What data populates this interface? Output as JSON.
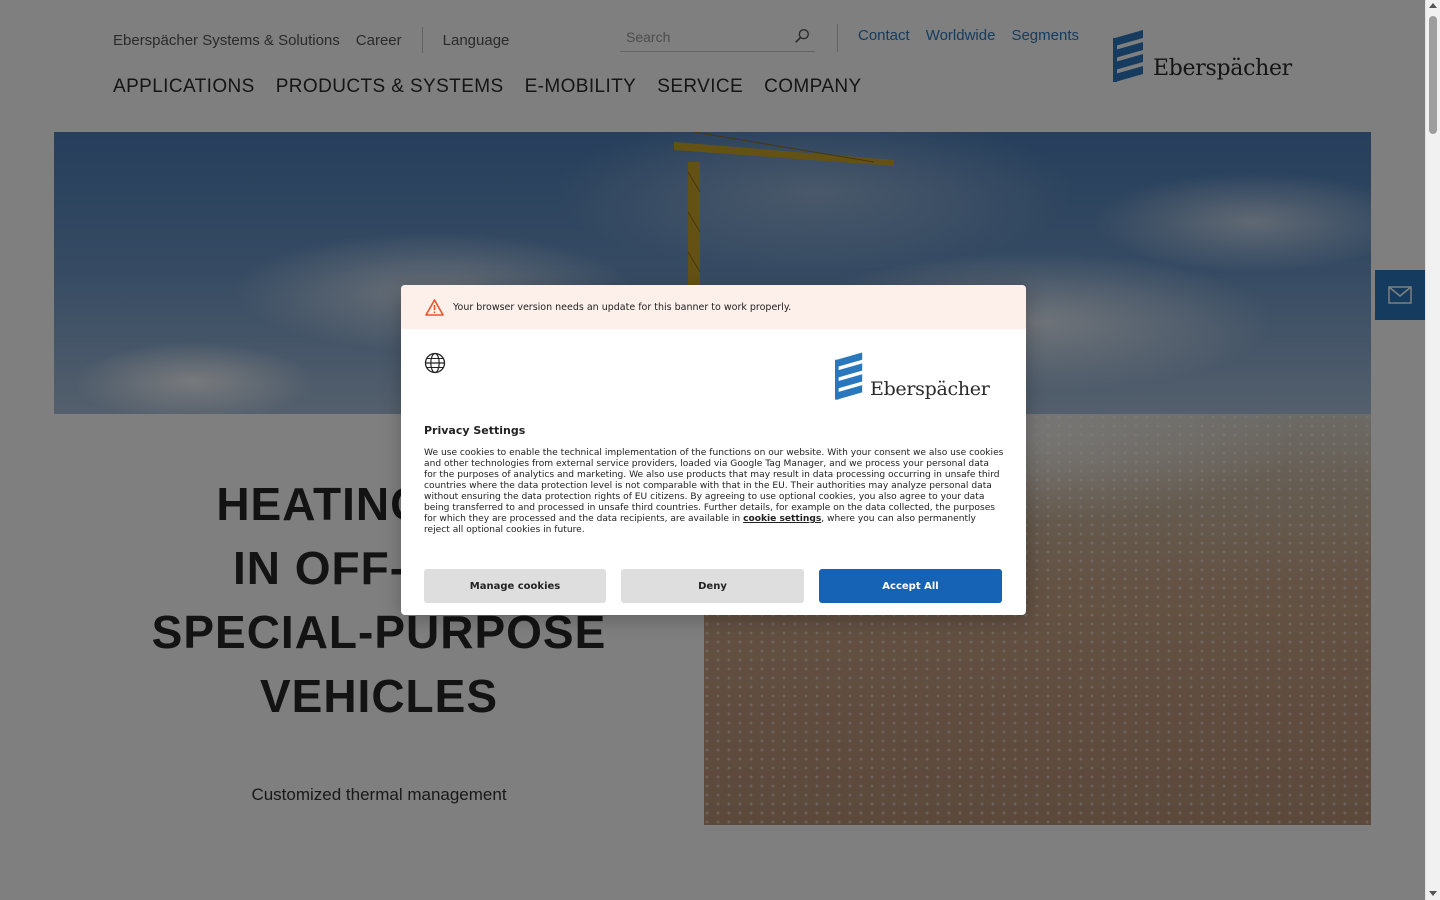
{
  "header": {
    "top_left_links": [
      "Eberspächer Systems & Solutions",
      "Career",
      "Language"
    ],
    "search_placeholder": "Search",
    "top_right_links": [
      "Contact",
      "Worldwide",
      "Segments"
    ],
    "logo_text": "Eberspächer"
  },
  "main_nav": [
    "APPLICATIONS",
    "PRODUCTS & SYSTEMS",
    "E-MOBILITY",
    "SERVICE",
    "COMPANY"
  ],
  "hero": {
    "headline_lines": [
      "HEATING AND",
      "IN OFF-HIGH",
      "SPECIAL-PURPOSE",
      "VEHICLES"
    ],
    "subline": "Customized thermal management"
  },
  "cookie_dialog": {
    "warning": "Your browser version needs an update for this banner to work properly.",
    "logo_text": "Eberspächer",
    "title": "Privacy Settings",
    "body_before_link": "We use cookies to enable the technical implementation of the functions on our website. With your consent we also use cookies and other technologies from external service providers, loaded via Google Tag Manager, and we process your personal data for the purposes of analytics and marketing. We also use products that may result in data processing occurring in unsafe third countries where the data protection level is not comparable with that in the EU. Their authorities may analyze personal data without ensuring the data protection rights of EU citizens. By agreeing to use optional cookies, you also agree to your data being transferred to and processed in unsafe third countries. Further details, for example on the data collected, the purposes for which they are processed and the data recipients, are available in ",
    "link_text": "cookie settings",
    "body_after_link": ", where you can also permanently reject all optional cookies in future.",
    "buttons": {
      "manage": "Manage cookies",
      "deny": "Deny",
      "accept": "Accept All"
    }
  },
  "colors": {
    "brand_blue": "#2a77bd",
    "accept_blue": "#1663b5",
    "warning_bg": "#fdf0ea",
    "warning_icon": "#e8542c"
  },
  "icons": [
    "search-icon",
    "mail-icon",
    "warning-icon",
    "globe-icon",
    "eberspaecher-logo-icon"
  ]
}
